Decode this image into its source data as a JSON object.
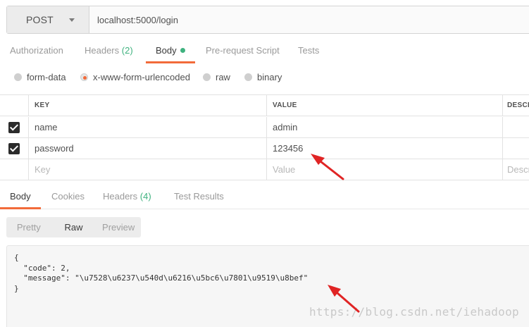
{
  "request": {
    "method": "POST",
    "url": "localhost:5000/login"
  },
  "request_tabs": [
    {
      "label": "Authorization"
    },
    {
      "label": "Headers",
      "count": "(2)"
    },
    {
      "label": "Body"
    },
    {
      "label": "Pre-request Script"
    },
    {
      "label": "Tests"
    }
  ],
  "body_types": [
    {
      "label": "form-data",
      "selected": false
    },
    {
      "label": "x-www-form-urlencoded",
      "selected": true
    },
    {
      "label": "raw",
      "selected": false
    },
    {
      "label": "binary",
      "selected": false
    }
  ],
  "params_table": {
    "headers": [
      "KEY",
      "VALUE",
      "DESCR"
    ],
    "rows": [
      {
        "key": "name",
        "value": "admin",
        "checked": true
      },
      {
        "key": "password",
        "value": "123456",
        "checked": true
      }
    ],
    "placeholders": {
      "key": "Key",
      "value": "Value",
      "description": "Descr"
    }
  },
  "response_tabs": [
    {
      "label": "Body"
    },
    {
      "label": "Cookies"
    },
    {
      "label": "Headers",
      "count": "(4)"
    },
    {
      "label": "Test Results"
    }
  ],
  "view_modes": [
    {
      "label": "Pretty"
    },
    {
      "label": "Raw"
    },
    {
      "label": "Preview"
    }
  ],
  "response_body": "{\n  \"code\": 2,\n  \"message\": \"\\u7528\\u6237\\u540d\\u6216\\u5bc6\\u7801\\u9519\\u8bef\"\n}",
  "watermark": "https://blog.csdn.net/iehadoop",
  "colors": {
    "accent": "#f26b3a",
    "count": "#3fb27f",
    "arrow": "#e02424"
  }
}
